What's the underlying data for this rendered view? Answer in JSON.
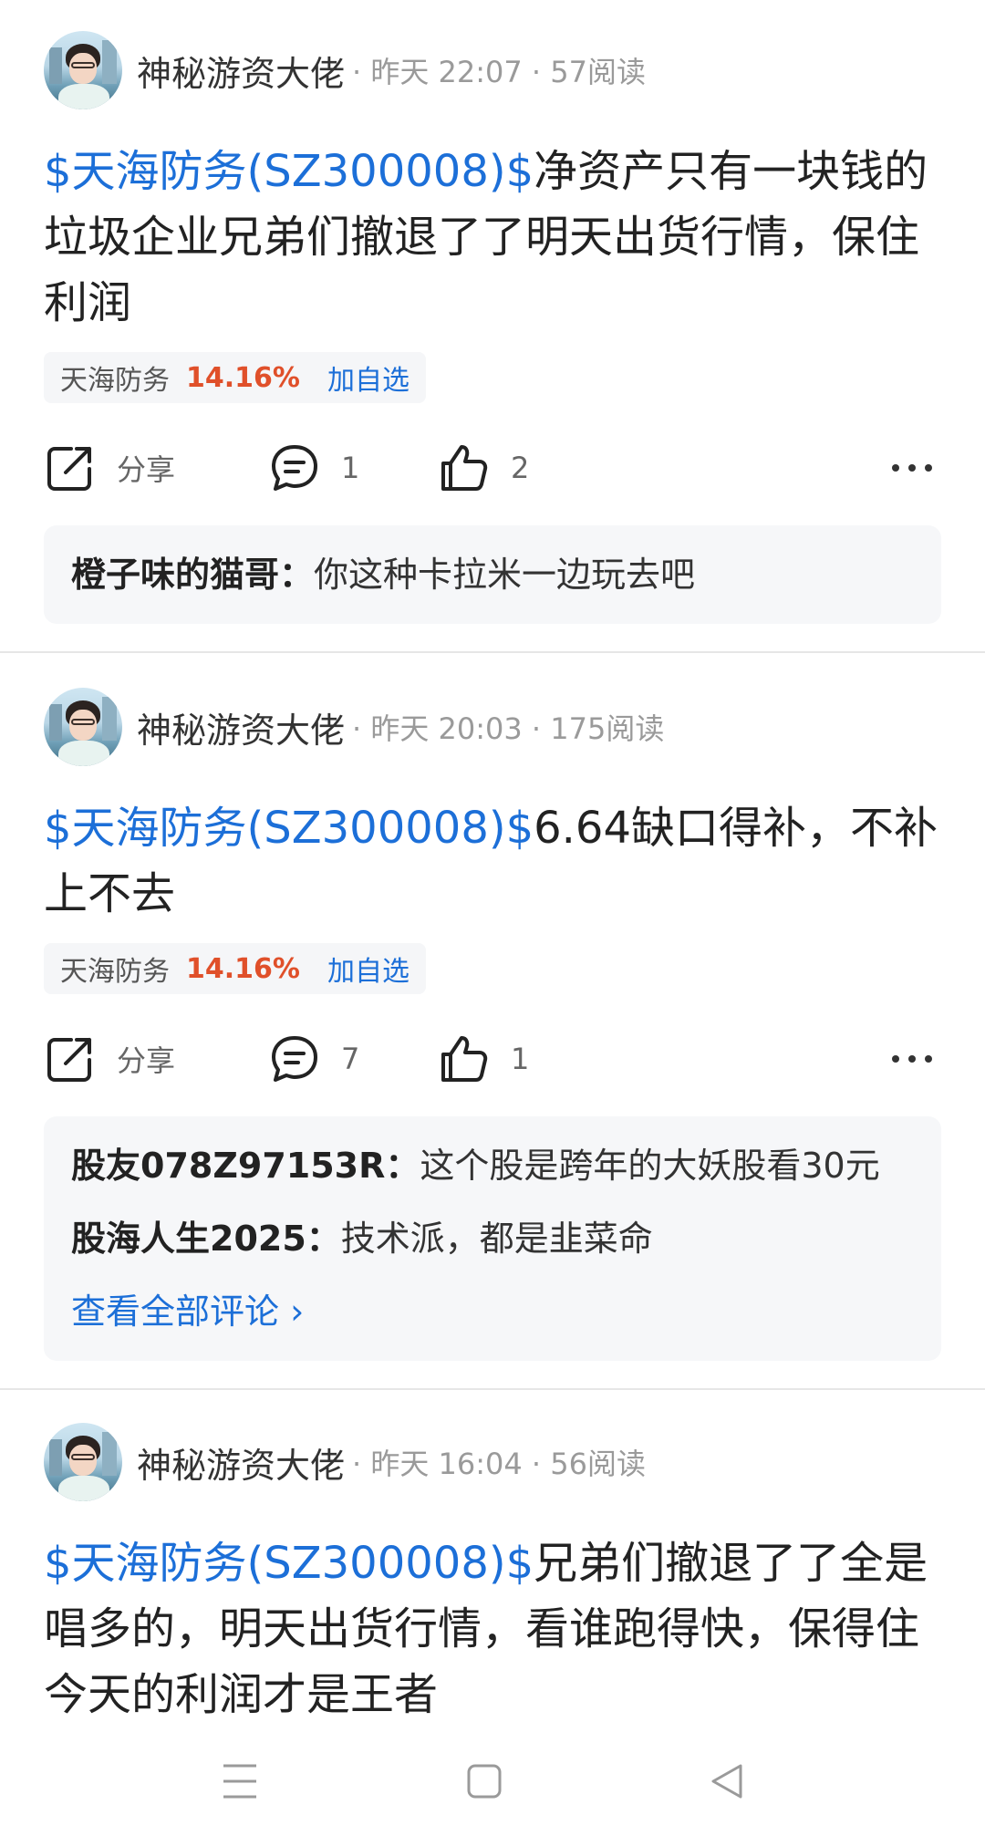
{
  "posts": [
    {
      "author": "神秘游资大佬",
      "meta": "· 昨天 22:07 · 57阅读",
      "tag": "$天海防务(SZ300008)$",
      "text": "净资产只有一块钱的垃圾企业兄弟们撤退了了明天出货行情，保住利润",
      "stock": {
        "name": "天海防务",
        "change": "14.16%",
        "add": "加自选"
      },
      "share_label": "分享",
      "comment_count": "1",
      "like_count": "2",
      "comments": [
        {
          "user": "橙子味的猫哥：",
          "text": "你这种卡拉米一边玩去吧"
        }
      ]
    },
    {
      "author": "神秘游资大佬",
      "meta": "· 昨天 20:03 · 175阅读",
      "tag": "$天海防务(SZ300008)$",
      "text": "6.64缺口得补，不补上不去",
      "stock": {
        "name": "天海防务",
        "change": "14.16%",
        "add": "加自选"
      },
      "share_label": "分享",
      "comment_count": "7",
      "like_count": "1",
      "comments": [
        {
          "user": "股友078Z97153R：",
          "text": "这个股是跨年的大妖股看30元"
        },
        {
          "user": "股海人生2025：",
          "text": "技术派，都是韭菜命"
        }
      ],
      "view_all": "查看全部评论 ›"
    },
    {
      "author": "神秘游资大佬",
      "meta": "· 昨天 16:04 · 56阅读",
      "tag": "$天海防务(SZ300008)$",
      "text": "兄弟们撤退了了全是唱多的，明天出货行情，看谁跑得快，保得住今天的利润才是王者"
    }
  ],
  "colors": {
    "link": "#1c6fd8",
    "rise": "#e0502a",
    "panel": "#f6f7f9"
  },
  "icons": [
    "share-icon",
    "comment-icon",
    "like-icon",
    "more-icon",
    "menu-icon",
    "home-icon",
    "back-icon"
  ]
}
